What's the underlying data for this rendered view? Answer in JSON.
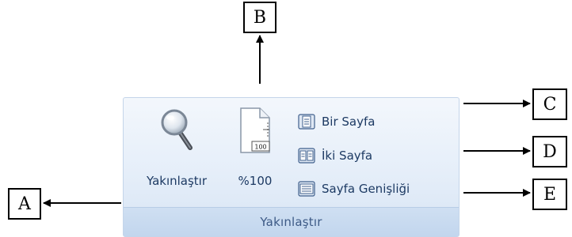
{
  "ribbon_group": {
    "name": "Yakınlaştır",
    "buttons": {
      "zoom": {
        "label": "Yakınlaştır",
        "icon": "magnifier-icon"
      },
      "hundred": {
        "label": "%100",
        "icon_badge": "100",
        "icon": "page-100-icon"
      },
      "one_page": {
        "label": "Bir Sayfa",
        "icon": "one-page-icon"
      },
      "two_pages": {
        "label": "İki Sayfa",
        "icon": "two-pages-icon"
      },
      "page_width": {
        "label": "Sayfa Genişliği",
        "icon": "page-width-icon"
      }
    }
  },
  "callouts": {
    "a": "A",
    "b": "B",
    "c": "C",
    "d": "D",
    "e": "E"
  },
  "colors": {
    "ribbon_bg": "#e5eef9",
    "ribbon_border": "#c4d5ea",
    "label_text": "#1d3a63",
    "footer_text": "#3d5a86"
  }
}
